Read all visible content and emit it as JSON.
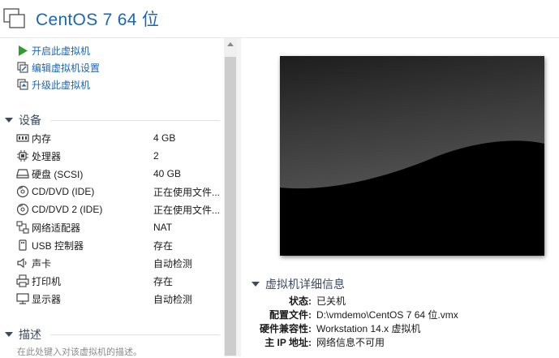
{
  "header": {
    "title": "CentOS 7 64 位"
  },
  "actions": [
    {
      "label": "开启此虚拟机",
      "icon": "play-icon"
    },
    {
      "label": "编辑虚拟机设置",
      "icon": "edit-settings-icon"
    },
    {
      "label": "升级此虚拟机",
      "icon": "upgrade-icon"
    }
  ],
  "devices": {
    "heading": "设备",
    "items": [
      {
        "name": "内存",
        "value": "4 GB",
        "icon": "memory-icon"
      },
      {
        "name": "处理器",
        "value": "2",
        "icon": "cpu-icon"
      },
      {
        "name": "硬盘 (SCSI)",
        "value": "40 GB",
        "icon": "hard-disk-icon"
      },
      {
        "name": "CD/DVD (IDE)",
        "value": "正在使用文件...",
        "icon": "cd-dvd-icon"
      },
      {
        "name": "CD/DVD 2 (IDE)",
        "value": "正在使用文件...",
        "icon": "cd-dvd-icon"
      },
      {
        "name": "网络适配器",
        "value": "NAT",
        "icon": "network-adapter-icon"
      },
      {
        "name": "USB 控制器",
        "value": "存在",
        "icon": "usb-icon"
      },
      {
        "name": "声卡",
        "value": "自动检测",
        "icon": "sound-card-icon"
      },
      {
        "name": "打印机",
        "value": "存在",
        "icon": "printer-icon"
      },
      {
        "name": "显示器",
        "value": "自动检测",
        "icon": "display-icon"
      }
    ]
  },
  "description": {
    "heading": "描述",
    "placeholder": "在此处键入对该虚拟机的描述。"
  },
  "details": {
    "heading": "虚拟机详细信息",
    "rows": [
      {
        "key": "状态:",
        "value": "已关机"
      },
      {
        "key": "配置文件:",
        "value": "D:\\vmdemo\\CentOS 7 64 位.vmx"
      },
      {
        "key": "硬件兼容性:",
        "value": "Workstation 14.x 虚拟机"
      },
      {
        "key": "主 IP 地址:",
        "value": "网络信息不可用"
      }
    ]
  },
  "colors": {
    "title": "#1a66b8",
    "link": "#1a66b8",
    "section_heading": "#3b4a63",
    "play_green": "#2e9e2e"
  }
}
